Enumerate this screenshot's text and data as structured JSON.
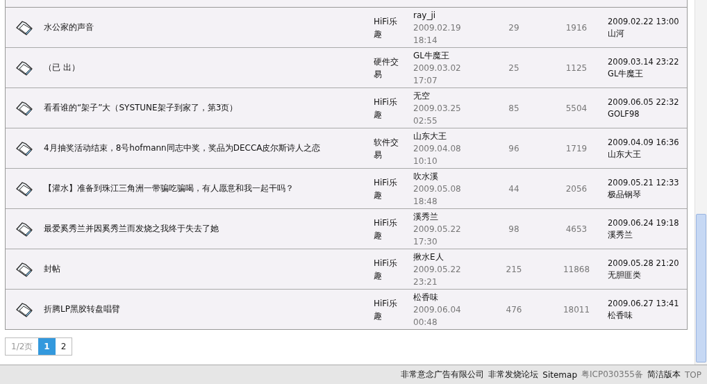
{
  "threads": [
    {
      "title": "水公家的声音",
      "forum": "HiFi乐趣",
      "author": "ray_ji",
      "posted": "2009.02.19 18:14",
      "replies": "29",
      "views": "1916",
      "last_time": "2009.02.22 13:00",
      "last_user": "山河"
    },
    {
      "title": "（已 出）",
      "forum": "硬件交易",
      "author": "GL牛魔王",
      "posted": "2009.03.02 17:07",
      "replies": "25",
      "views": "1125",
      "last_time": "2009.03.14 23:22",
      "last_user": "GL牛魔王"
    },
    {
      "title": "看看谁的“架子”大（SYSTUNE架子到家了，第3页）",
      "forum": "HiFi乐趣",
      "author": "无空",
      "posted": "2009.03.25 02:55",
      "replies": "85",
      "views": "5504",
      "last_time": "2009.06.05 22:32",
      "last_user": "GOLF98"
    },
    {
      "title": "4月抽奖活动结束，8号hofmann同志中奖，奖品为DECCA皮尔斯诗人之恋",
      "forum": "软件交易",
      "author": "山东大王",
      "posted": "2009.04.08 10:10",
      "replies": "96",
      "views": "1719",
      "last_time": "2009.04.09 16:36",
      "last_user": "山东大王"
    },
    {
      "title": "【灌水】准备到珠江三角洲一带骗吃骗喝，有人愿意和我一起干吗？",
      "forum": "HiFi乐趣",
      "author": "吹水溪",
      "posted": "2009.05.08 18:48",
      "replies": "44",
      "views": "2056",
      "last_time": "2009.05.21 12:33",
      "last_user": "极品钢琴"
    },
    {
      "title": "最爱奚秀兰并因奚秀兰而发烧之我终于失去了她",
      "forum": "HiFi乐趣",
      "author": "溪秀兰",
      "posted": "2009.05.22 17:30",
      "replies": "98",
      "views": "4653",
      "last_time": "2009.06.24 19:18",
      "last_user": "溪秀兰"
    },
    {
      "title": "封帖",
      "forum": "HiFi乐趣",
      "author": "揪水E人",
      "posted": "2009.05.22 23:21",
      "replies": "215",
      "views": "11868",
      "last_time": "2009.05.28 21:20",
      "last_user": "无胆匪类"
    },
    {
      "title": "折腾LP黑胶转盘唱臂",
      "forum": "HiFi乐趣",
      "author": "松香味",
      "posted": "2009.06.04 00:48",
      "replies": "476",
      "views": "18011",
      "last_time": "2009.06.27 13:41",
      "last_user": "松香味"
    }
  ],
  "pagination": {
    "info": "1/2页",
    "pages": [
      {
        "label": "1",
        "selected": true
      },
      {
        "label": "2",
        "selected": false
      }
    ]
  },
  "footer": [
    {
      "text": "非常意念广告有限公司",
      "kind": "link"
    },
    {
      "text": "非常发烧论坛",
      "kind": "link"
    },
    {
      "text": "Sitemap",
      "kind": "link"
    },
    {
      "text": "粤ICP030355备",
      "kind": "note"
    },
    {
      "text": "简洁版本",
      "kind": "link"
    },
    {
      "text": "TOP",
      "kind": "note"
    }
  ]
}
